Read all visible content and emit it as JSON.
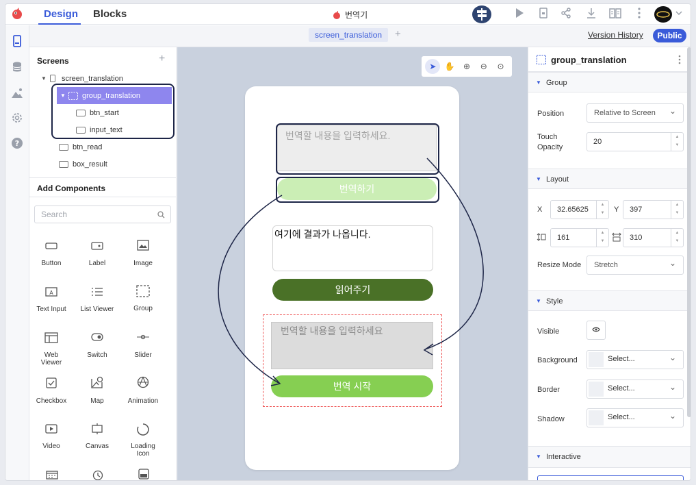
{
  "topbar": {
    "tab_design": "Design",
    "tab_blocks": "Blocks",
    "app_title": "번역기"
  },
  "secondbar": {
    "screen_tab": "screen_translation",
    "add_tab": "+",
    "version_history": "Version History",
    "public": "Public"
  },
  "screens": {
    "title": "Screens",
    "add": "+",
    "items": [
      {
        "label": "screen_translation"
      },
      {
        "label": "group_translation"
      },
      {
        "label": "btn_start"
      },
      {
        "label": "input_text"
      },
      {
        "label": "btn_read"
      },
      {
        "label": "box_result"
      }
    ]
  },
  "add_components": {
    "title": "Add Components",
    "search_placeholder": "Search",
    "items": [
      {
        "label": "Button",
        "icon": "button-icon"
      },
      {
        "label": "Label",
        "icon": "label-icon"
      },
      {
        "label": "Image",
        "icon": "image-icon"
      },
      {
        "label": "Text Input",
        "icon": "text-input-icon"
      },
      {
        "label": "List Viewer",
        "icon": "list-viewer-icon"
      },
      {
        "label": "Group",
        "icon": "group-icon"
      },
      {
        "label": "Web\nViewer",
        "icon": "web-viewer-icon"
      },
      {
        "label": "Switch",
        "icon": "switch-icon"
      },
      {
        "label": "Slider",
        "icon": "slider-icon"
      },
      {
        "label": "Checkbox",
        "icon": "checkbox-icon"
      },
      {
        "label": "Map",
        "icon": "map-icon"
      },
      {
        "label": "Animation",
        "icon": "animation-icon"
      },
      {
        "label": "Video",
        "icon": "video-icon"
      },
      {
        "label": "Canvas",
        "icon": "canvas-icon"
      },
      {
        "label": "Loading\nIcon",
        "icon": "loading-icon"
      }
    ]
  },
  "phone": {
    "input_placeholder": "번역할 내용을 입력하세요.",
    "btn_translate": "번역하기",
    "result_text": "여기에 결과가 나옵니다.",
    "btn_read": "읽어주기",
    "input2_placeholder": "번역할 내용을 입력하세요",
    "btn_start": "번역 시작"
  },
  "inspector": {
    "title": "group_translation",
    "group_section": "Group",
    "position_label": "Position",
    "position_value": "Relative to Screen",
    "touch_opacity_label": "Touch\nOpacity",
    "touch_opacity_value": "20",
    "layout_section": "Layout",
    "x_label": "X",
    "x_value": "32.65625",
    "y_label": "Y",
    "y_value": "397",
    "height_value": "161",
    "width_value": "310",
    "resize_mode_label": "Resize Mode",
    "resize_mode_value": "Stretch",
    "style_section": "Style",
    "visible_label": "Visible",
    "background_label": "Background",
    "background_value": "Select...",
    "border_label": "Border",
    "border_value": "Select...",
    "shadow_label": "Shadow",
    "shadow_value": "Select...",
    "interactive_section": "Interactive"
  },
  "colors": {
    "accent": "#3a5bd9",
    "selected_row": "#8e86ee",
    "canvas_bg": "#c9d1de",
    "btn_light": "#cbeeb5",
    "btn_dark": "#4a7127",
    "btn_green": "#86cf52"
  }
}
